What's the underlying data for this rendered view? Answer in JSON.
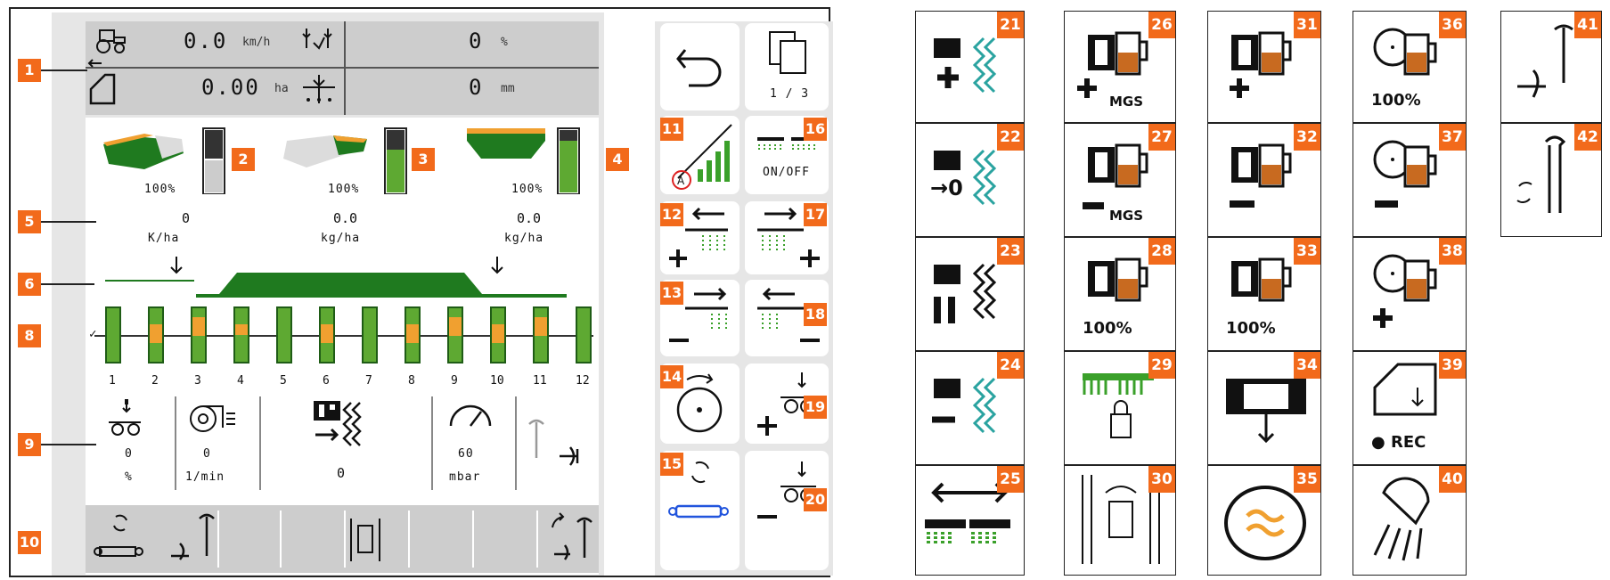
{
  "screen": {
    "speed_value": "0.0",
    "speed_unit": "km/h",
    "rate_value": "0",
    "rate_unit": "%",
    "area_value": "0.00",
    "area_unit": "ha",
    "depth_value": "0",
    "depth_unit": "mm",
    "hopper1_pct": "100%",
    "hopper2_pct": "100%",
    "hopper3_pct": "100%",
    "rate1_value": "0",
    "rate1_unit": "K/ha",
    "rate2_value": "0.0",
    "rate2_unit": "kg/ha",
    "rate3_value": "0.0",
    "rate3_unit": "kg/ha",
    "row_numbers": [
      "1",
      "2",
      "3",
      "4",
      "5",
      "6",
      "7",
      "8",
      "9",
      "10",
      "11",
      "12"
    ],
    "status1_value": "0",
    "status1_unit": "%",
    "status2_value": "0",
    "status2_unit": "1/min",
    "status3_value": "0",
    "status4_value": "60",
    "status4_unit": "mbar",
    "page_indicator": "1 / 3",
    "onoff_label": "ON/OFF"
  },
  "callouts": [
    "1",
    "2",
    "3",
    "4",
    "5",
    "6",
    "8",
    "9",
    "10",
    "11",
    "12",
    "13",
    "14",
    "15",
    "16",
    "17",
    "18",
    "19",
    "20"
  ],
  "icon_grid": [
    {
      "num": "21",
      "caption": ""
    },
    {
      "num": "22",
      "caption": "→0"
    },
    {
      "num": "23",
      "caption": ""
    },
    {
      "num": "24",
      "caption": ""
    },
    {
      "num": "25",
      "caption": ""
    },
    {
      "num": "26",
      "caption": "MGS"
    },
    {
      "num": "27",
      "caption": "MGS"
    },
    {
      "num": "28",
      "caption": "100%"
    },
    {
      "num": "29",
      "caption": ""
    },
    {
      "num": "30",
      "caption": ""
    },
    {
      "num": "31",
      "caption": ""
    },
    {
      "num": "32",
      "caption": ""
    },
    {
      "num": "33",
      "caption": "100%"
    },
    {
      "num": "34",
      "caption": ""
    },
    {
      "num": "35",
      "caption": ""
    },
    {
      "num": "36",
      "caption": "100%"
    },
    {
      "num": "37",
      "caption": ""
    },
    {
      "num": "38",
      "caption": ""
    },
    {
      "num": "39",
      "caption": "● REC"
    },
    {
      "num": "40",
      "caption": ""
    },
    {
      "num": "41",
      "caption": ""
    },
    {
      "num": "42",
      "caption": ""
    }
  ],
  "colors": {
    "accent": "#f26a1b",
    "green": "#5ea932",
    "darkgreen": "#1f7a1f",
    "orange": "#f0a030",
    "grey": "#cdcdcd"
  },
  "chart_like": {
    "seed_bar_fill_fraction": [
      0,
      0.35,
      0.35,
      0.2,
      0,
      0.35,
      0,
      0.35,
      0.35,
      0.35,
      0.35,
      0
    ]
  }
}
